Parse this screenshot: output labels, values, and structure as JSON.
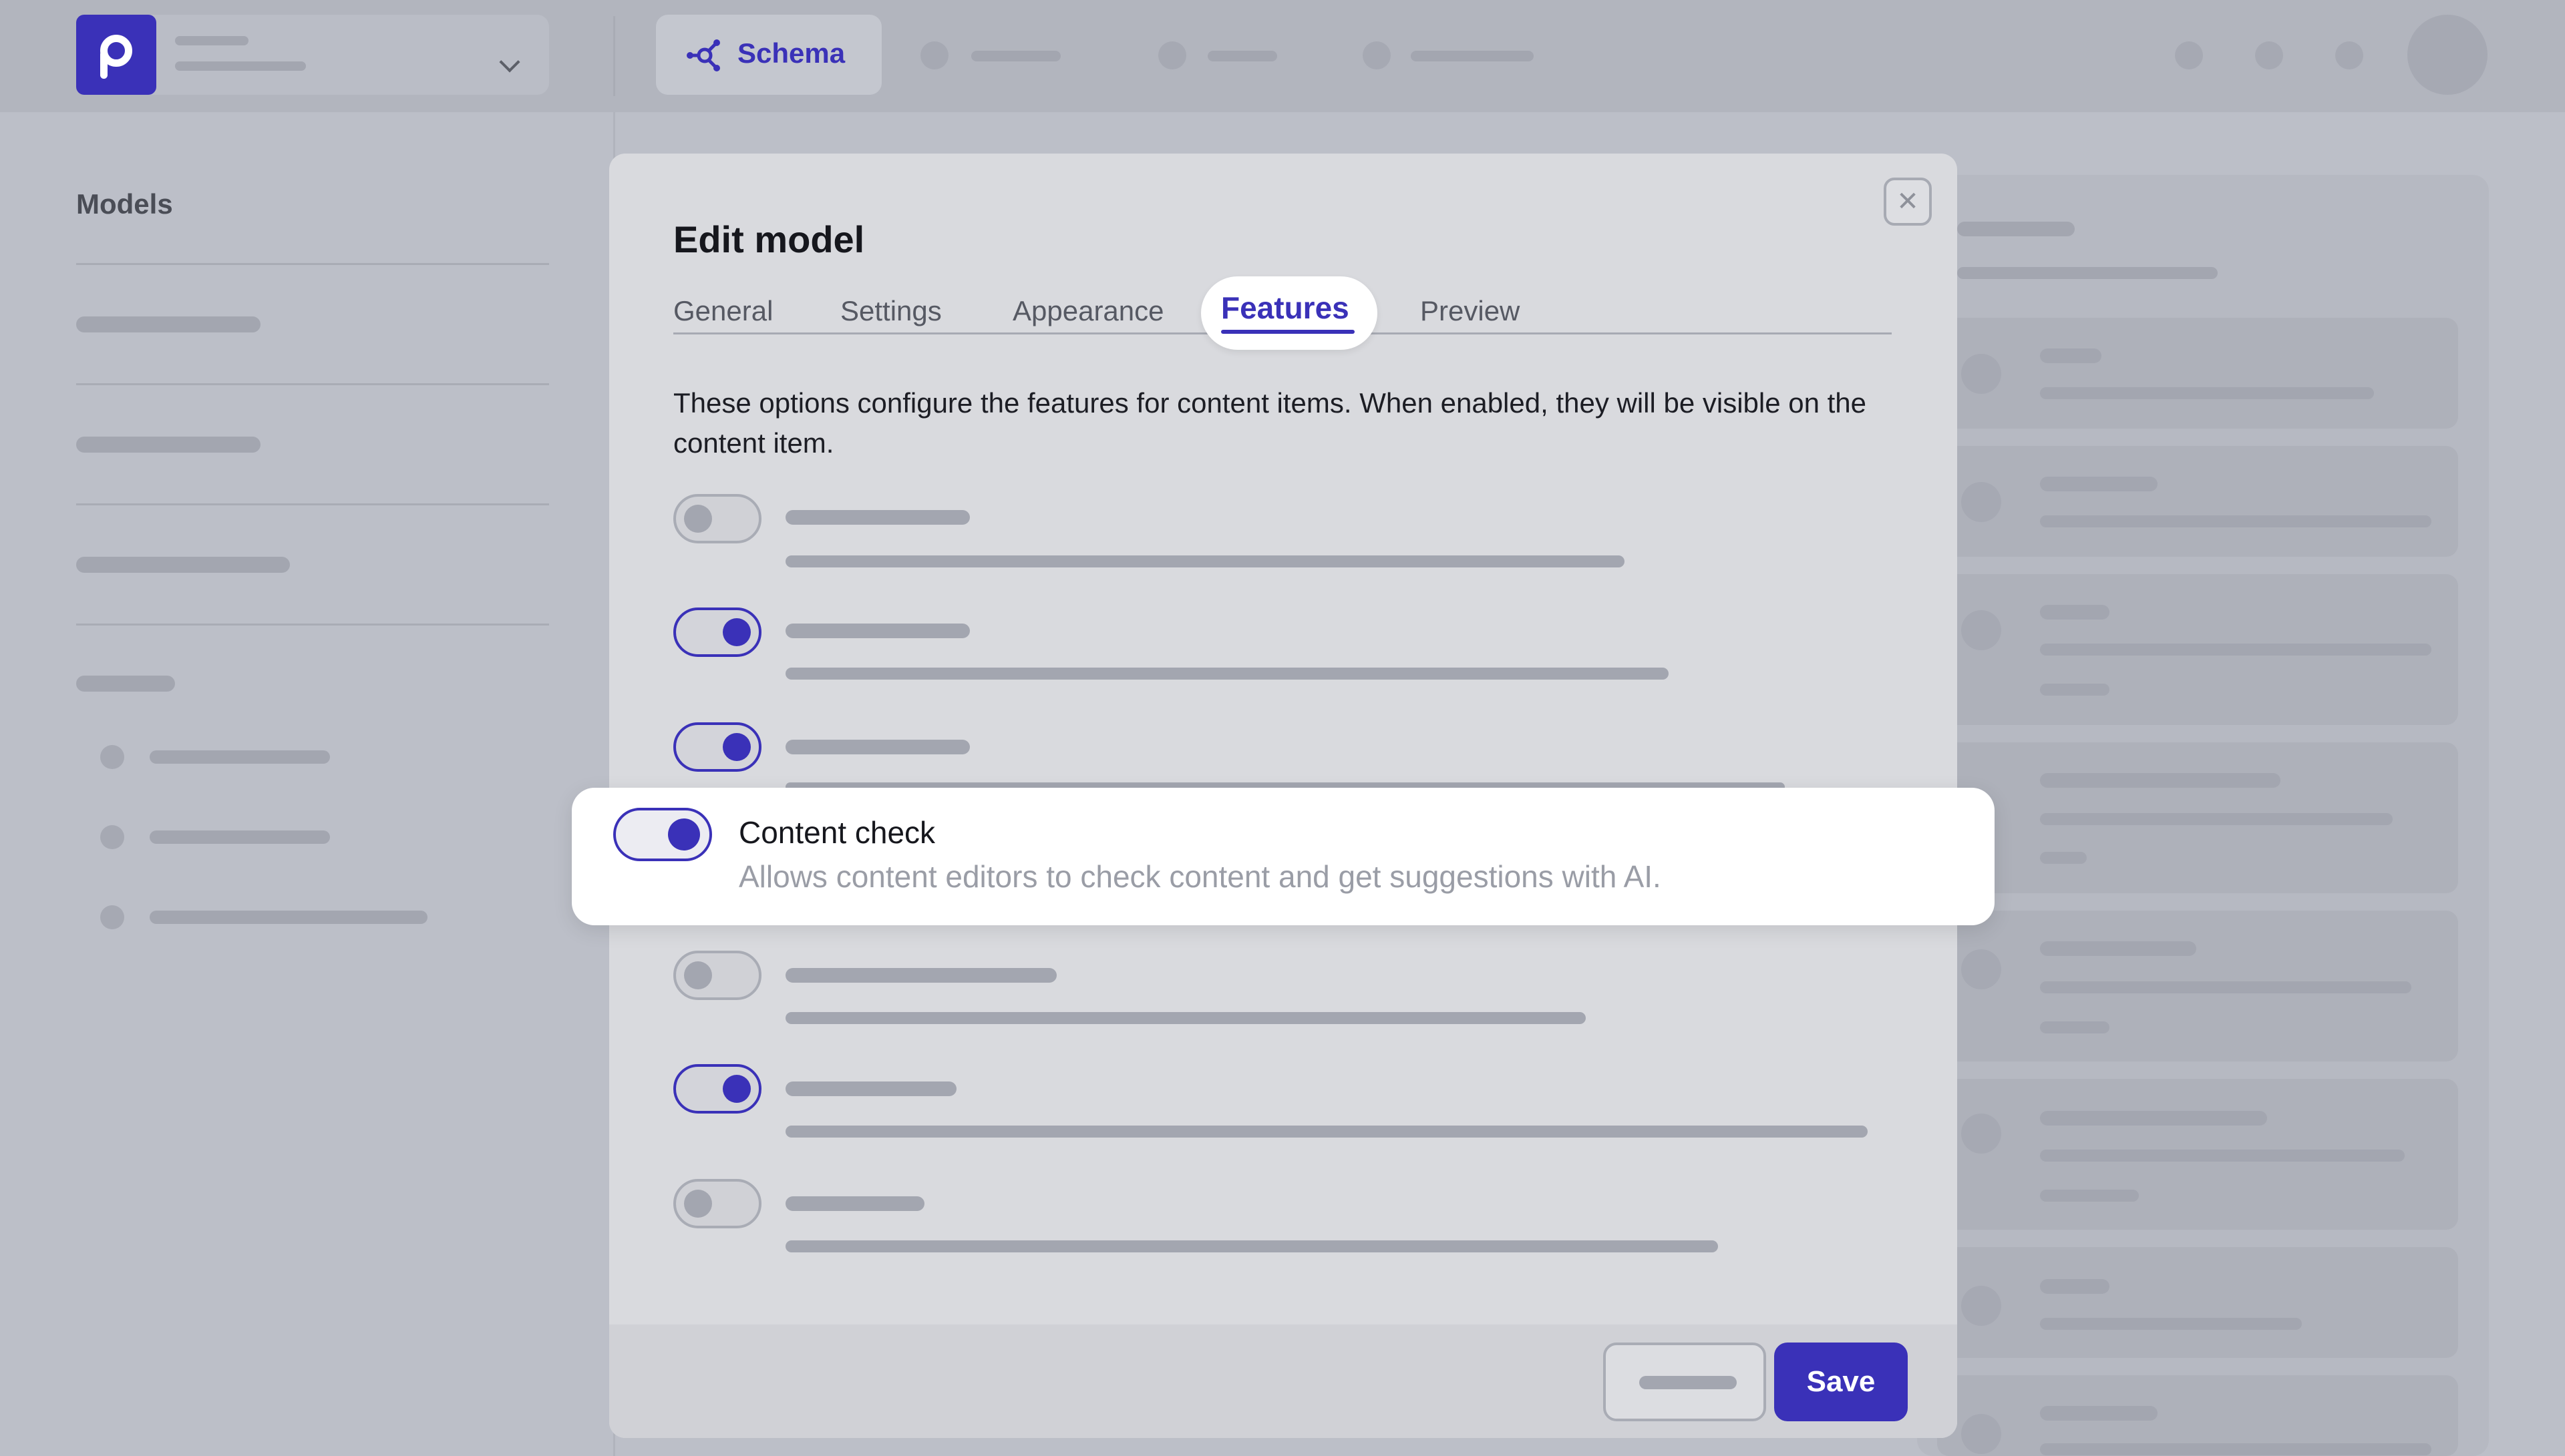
{
  "header": {
    "active_tab": "Schema",
    "colors": {
      "brand": "#3a31b8",
      "background": "#bcbfc8"
    }
  },
  "sidebar": {
    "title": "Models"
  },
  "modal": {
    "title": "Edit model",
    "tabs": [
      {
        "label": "General"
      },
      {
        "label": "Settings"
      },
      {
        "label": "Appearance"
      },
      {
        "label": "Features",
        "active": true
      },
      {
        "label": "Preview"
      }
    ],
    "description": "These options configure the features for content items. When enabled, they will be visible on the content item.",
    "features": [
      {
        "enabled": false
      },
      {
        "enabled": true
      },
      {
        "enabled": true
      },
      {
        "enabled": true,
        "title": "Content check",
        "description": "Allows content editors to check content and get suggestions with AI."
      },
      {
        "enabled": false
      },
      {
        "enabled": true
      },
      {
        "enabled": false
      }
    ],
    "close_icon": "close-icon",
    "save_label": "Save"
  }
}
